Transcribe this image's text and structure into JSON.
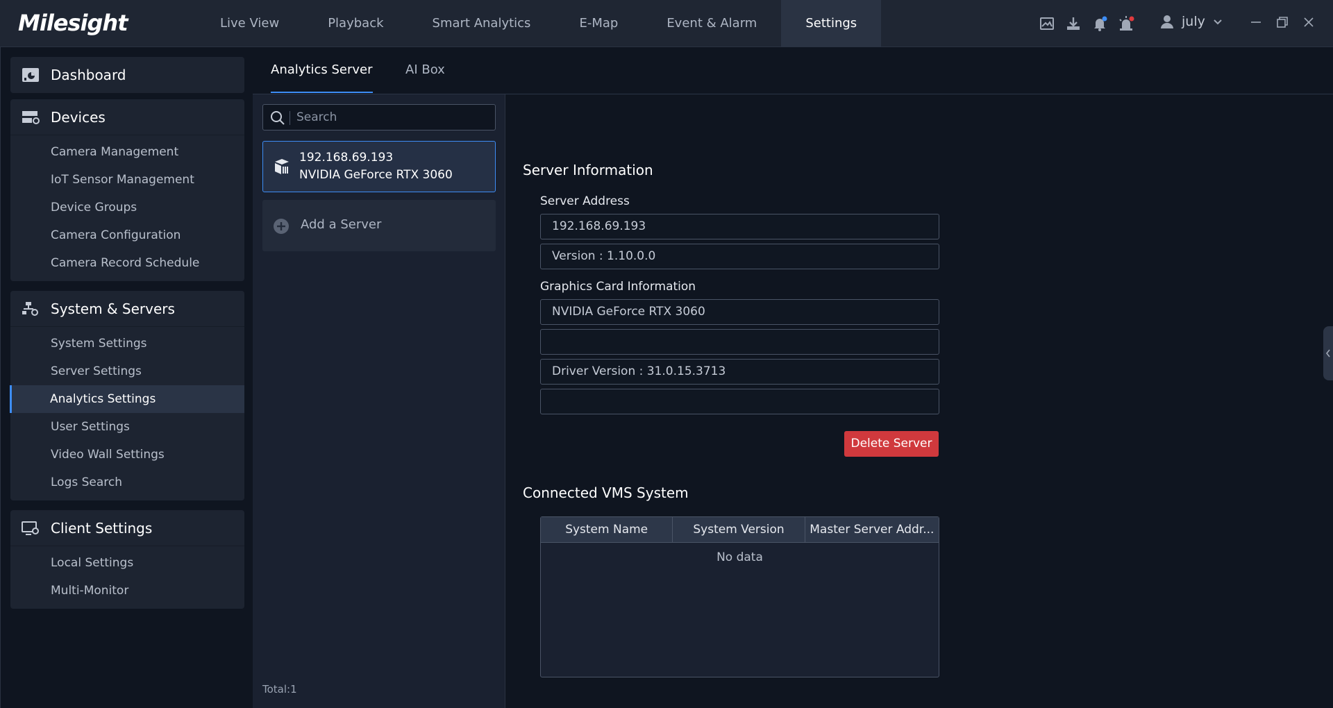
{
  "app": {
    "logo": "Milesight",
    "nav": [
      "Live View",
      "Playback",
      "Smart Analytics",
      "E-Map",
      "Event & Alarm",
      "Settings"
    ],
    "active_nav": "Settings",
    "user": "july"
  },
  "sidebar": {
    "groups": [
      {
        "title": "Dashboard",
        "icon": "dashboard-icon",
        "items": []
      },
      {
        "title": "Devices",
        "icon": "devices-icon",
        "items": [
          "Camera Management",
          "IoT Sensor Management",
          "Device Groups",
          "Camera Configuration",
          "Camera Record Schedule"
        ]
      },
      {
        "title": "System & Servers",
        "icon": "system-servers-icon",
        "items": [
          "System Settings",
          "Server Settings",
          "Analytics Settings",
          "User Settings",
          "Video Wall Settings",
          "Logs Search"
        ]
      },
      {
        "title": "Client Settings",
        "icon": "client-settings-icon",
        "items": [
          "Local Settings",
          "Multi-Monitor"
        ]
      }
    ],
    "active_item": "Analytics Settings"
  },
  "tabs": [
    "Analytics Server",
    "AI Box"
  ],
  "active_tab": "Analytics Server",
  "server_list": {
    "search_placeholder": "Search",
    "servers": [
      {
        "ip": "192.168.69.193",
        "gpu": "NVIDIA GeForce RTX 3060"
      }
    ],
    "add_label": "Add a Server",
    "total": "Total:1"
  },
  "server_info": {
    "title": "Server Information",
    "address_label": "Server Address",
    "address": "192.168.69.193",
    "version": "Version : 1.10.0.0",
    "gpu_label": "Graphics Card Information",
    "gpu_name": "NVIDIA GeForce RTX 3060",
    "gpu_field2": "",
    "driver": "Driver Version : 31.0.15.3713",
    "gpu_field4": "",
    "delete_label": "Delete Server"
  },
  "vms": {
    "title": "Connected VMS System",
    "columns": [
      "System Name",
      "System Version",
      "Master Server Addr..."
    ],
    "empty": "No data"
  },
  "colors": {
    "accent": "#3d8df5",
    "danger": "#d0393d",
    "topbar": "#1f2633",
    "background": "#0f1520"
  }
}
